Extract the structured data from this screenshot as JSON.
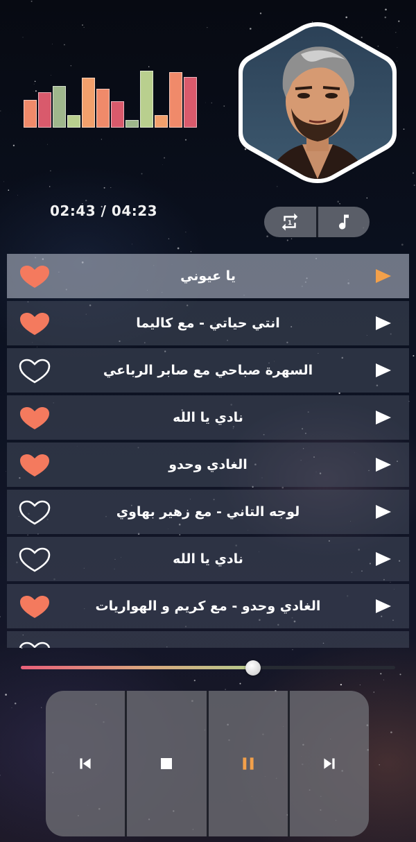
{
  "player": {
    "elapsed": "02:43",
    "duration": "04:23",
    "time_separator": "/",
    "time_display": "04:23 / 02:43",
    "progress_fraction": 0.62
  },
  "equalizer": {
    "levels": [
      0.46,
      0.58,
      0.68,
      0.2,
      0.82,
      0.64,
      0.43,
      0.12,
      0.93,
      0.2,
      0.91,
      0.83
    ],
    "colors": [
      "#f08a6a",
      "#d95a6c",
      "#9fb78c",
      "#b9cf8e",
      "#f2a06c",
      "#f08a6a",
      "#d95a6c",
      "#9fb78c",
      "#b9cf8e",
      "#f2a06c",
      "#f08a6a",
      "#d95a6c"
    ]
  },
  "toolbar": {
    "repeat_icon": "repeat-one-icon",
    "music_icon": "music-note-icon"
  },
  "playlist": [
    {
      "title": "يا عيوني",
      "liked": true,
      "active": true
    },
    {
      "title": "انتي حياتي - مع كاليما",
      "liked": true,
      "active": false
    },
    {
      "title": "السهرة صباحي مع صابر الرباعي",
      "liked": false,
      "active": false
    },
    {
      "title": "نادي يا الله",
      "liked": true,
      "active": false
    },
    {
      "title": "الغادي وحدو",
      "liked": true,
      "active": false
    },
    {
      "title": "لوجه التاني - مع زهير بهاوي",
      "liked": false,
      "active": false
    },
    {
      "title": "نادي يا الله",
      "liked": false,
      "active": false
    },
    {
      "title": "الغادي وحدو - مع كريم و الهواريات",
      "liked": true,
      "active": false
    }
  ],
  "controls": {
    "previous_icon": "skip-previous-icon",
    "stop_icon": "stop-icon",
    "pause_icon": "pause-icon",
    "next_icon": "skip-next-icon"
  },
  "colors": {
    "accent_orange": "#f2a04a",
    "heart": "#f47a5e",
    "text": "#ffffff"
  }
}
